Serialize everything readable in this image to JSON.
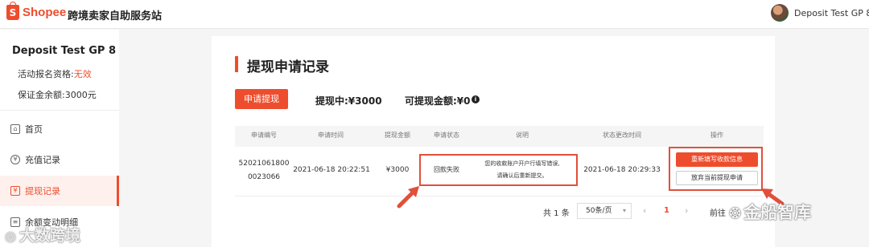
{
  "header": {
    "logo_text": "Shopee",
    "logo_icon": "shopee-bag-icon",
    "title": "跨境卖家自助服务站",
    "user_name": "Deposit Test GP 8"
  },
  "sidebar": {
    "account_name": "Deposit Test GP 8",
    "eligibility_label": "活动报名资格:",
    "eligibility_value": "无效",
    "deposit_label": "保证金余额:",
    "deposit_value": "3000元",
    "items": [
      {
        "label": "首页",
        "icon": "home-icon"
      },
      {
        "label": "充值记录",
        "icon": "yen-icon"
      },
      {
        "label": "提现记录",
        "icon": "withdraw-icon",
        "active": true
      },
      {
        "label": "余额变动明细",
        "icon": "document-icon"
      }
    ]
  },
  "main": {
    "title": "提现申请记录",
    "apply_button": "申请提现",
    "withdrawing": "提现中:¥3000",
    "available": "可提现金额:¥0",
    "table": {
      "headers": [
        "申请编号",
        "申请时间",
        "提现金额",
        "申请状态",
        "说明",
        "状态更改时间",
        "操作"
      ],
      "row": {
        "id_line1": "52021061800",
        "id_line2": "0023066",
        "apply_time": "2021-06-18 20:22:51",
        "amount": "¥3000",
        "status": "回款失败",
        "note_line1": "您的收款账户开户行填写错误,",
        "note_line2": "请确认后重新提交。",
        "change_time": "2021-06-18 20:29:33",
        "action_primary": "重新填写收款信息",
        "action_secondary": "放弃当前提现申请"
      }
    },
    "pagination": {
      "total": "共 1 条",
      "page_size": "50条/页",
      "prev": "‹",
      "current": "1",
      "next": "›",
      "goto": "前往"
    }
  },
  "watermarks": {
    "left": "大数跨境",
    "right": "金船智库"
  },
  "colors": {
    "brand": "#ee4d2d",
    "annotation": "#e0503a"
  }
}
